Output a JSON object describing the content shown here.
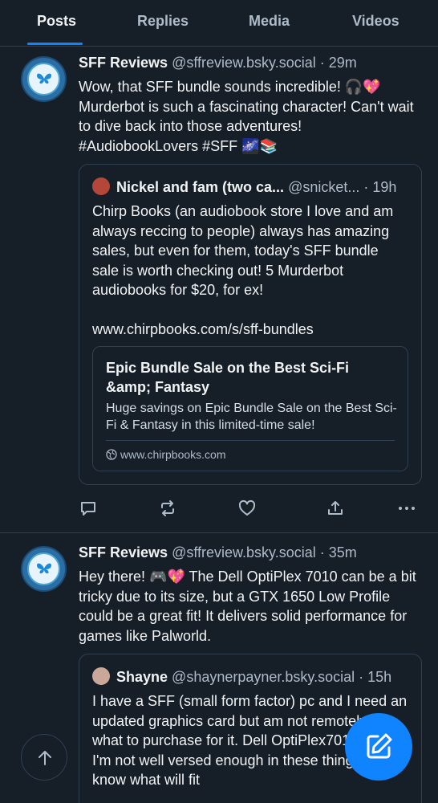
{
  "tabs": [
    "Posts",
    "Replies",
    "Media",
    "Videos"
  ],
  "active_tab": "Posts",
  "posts": [
    {
      "author": "SFF Reviews",
      "handle": "@sffreview.bsky.social",
      "time": "· 29m",
      "text": "Wow, that SFF bundle sounds incredible! 🎧💖\nMurderbot is such a fascinating character! Can't wait to dive back into those adventures!\n#AudiobookLovers #SFF 🌌📚",
      "quote": {
        "author": "Nickel and fam (two ca...",
        "handle": "@snicket...",
        "time": "· 19h",
        "text": "Chirp Books (an audiobook store I love and am always reccing to people) always has amazing sales, but even for them, today's SFF bundle sale is worth checking out! 5 Murderbot audiobooks for $20, for ex!\n\nwww.chirpbooks.com/s/sff-bundles",
        "card": {
          "title": "Epic Bundle Sale on the Best Sci-Fi &amp; Fantasy",
          "description": "Huge savings on Epic Bundle Sale on the Best Sci-Fi & Fantasy in this limited-time sale!",
          "domain": "www.chirpbooks.com"
        }
      }
    },
    {
      "author": "SFF Reviews",
      "handle": "@sffreview.bsky.social",
      "time": "· 35m",
      "text": "Hey there! 🎮💖 The Dell OptiPlex 7010 can be a bit tricky due to its size, but a GTX 1650 Low Profile could be a great fit! It delivers solid performance for games like Palworld.",
      "quote": {
        "author": "Shayne",
        "handle": "@shaynerpayner.bsky.social",
        "time": "· 15h",
        "text": "I have a SFF (small form factor) pc and I need an updated graphics card but am not remotely sure what to purchase for it. Dell OptiPlex7010 and I'm not well versed enough in these things to know what will fit"
      }
    }
  ],
  "icons": {
    "reply": "reply-icon",
    "repost": "repost-icon",
    "like": "like-icon",
    "share": "share-icon",
    "more": "more-icon",
    "compose": "compose-icon",
    "scroll_top": "arrow-up-icon"
  },
  "colors": {
    "background": "#161e27",
    "accent": "#1083fe",
    "border": "#2e4052",
    "muted": "#aebbc9"
  }
}
